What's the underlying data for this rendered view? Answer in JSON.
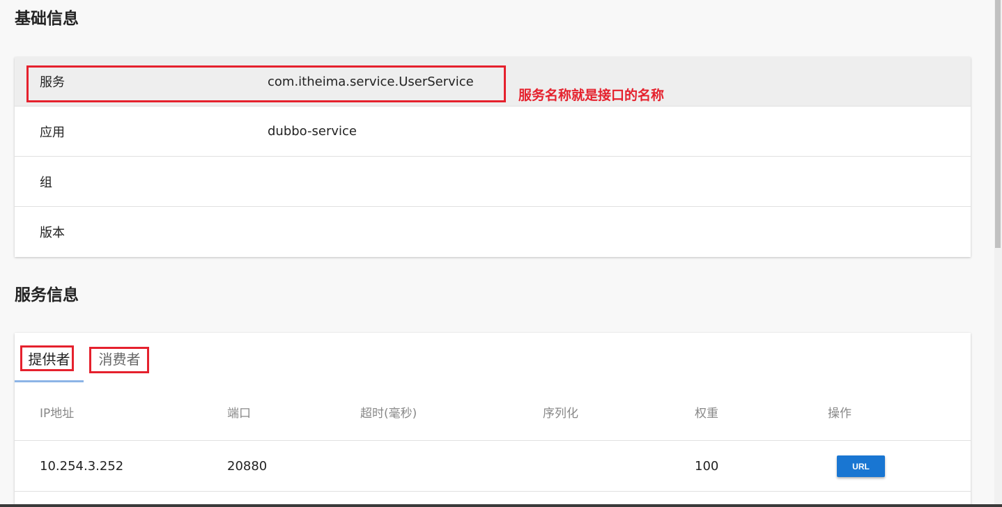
{
  "basic_info": {
    "title": "基础信息",
    "rows": [
      {
        "key": "服务",
        "value": "com.itheima.service.UserService"
      },
      {
        "key": "应用",
        "value": "dubbo-service"
      },
      {
        "key": "组",
        "value": ""
      },
      {
        "key": "版本",
        "value": ""
      }
    ],
    "annotation": "服务名称就是接口的名称"
  },
  "service_info": {
    "title": "服务信息",
    "tabs": [
      {
        "label": "提供者",
        "active": true
      },
      {
        "label": "消费者",
        "active": false
      }
    ],
    "table": {
      "headers": [
        "IP地址",
        "端口",
        "超时(毫秒)",
        "序列化",
        "权重",
        "操作"
      ],
      "rows": [
        {
          "ip": "10.254.3.252",
          "port": "20880",
          "timeout": "",
          "serialization": "",
          "weight": "100",
          "action_label": "URL"
        }
      ]
    }
  },
  "colors": {
    "annotation_red": "#e5212d",
    "primary_button": "#1976d2",
    "tab_indicator": "#8cb4e6"
  }
}
